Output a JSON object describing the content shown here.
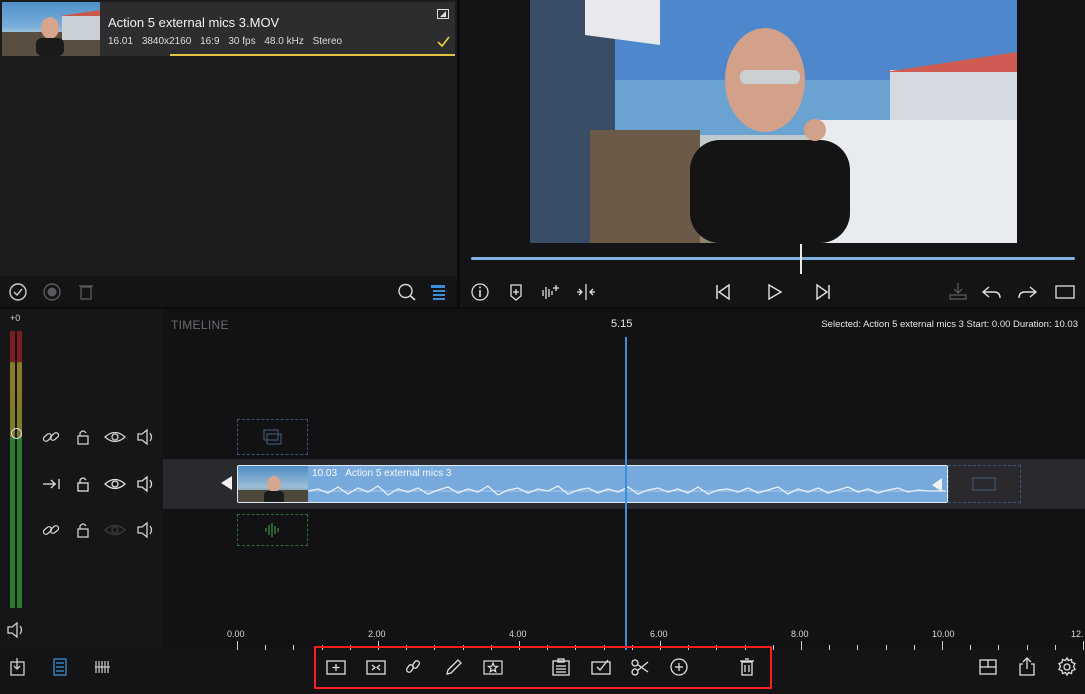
{
  "library": {
    "clip": {
      "name": "Action 5 external mics 3.MOV",
      "duration": "16.01",
      "resolution": "3840x2160",
      "aspect": "16:9",
      "fps": "30 fps",
      "sample_rate": "48.0 kHz",
      "channels": "Stereo",
      "progress": 0.63
    }
  },
  "timeline": {
    "label": "TIMELINE",
    "playhead_time": "5.15",
    "selection_info": "Selected: Action 5 external mics 3 Start: 0.00 Duration: 10.03",
    "clip": {
      "duration": "10.03",
      "name": "Action 5 external mics 3"
    },
    "ruler": [
      "0.00",
      "2.00",
      "4.00",
      "6.00",
      "8.00",
      "10.00",
      "12."
    ],
    "vu_label": "+0"
  },
  "colors": {
    "accent_blue": "#3a8fd6",
    "clip_blue": "#77a9dd",
    "highlight_red": "#ff1e1e",
    "progress_yellow": "#e4c441"
  },
  "icons": {
    "library_toolbar": [
      "check-circle-icon",
      "record-icon",
      "trash-icon",
      "search-icon",
      "layers-icon"
    ],
    "viewer_toolbar": [
      "info-icon",
      "marker-icon",
      "audio-waveform-add-icon",
      "split-icon",
      "skip-back-icon",
      "play-icon",
      "skip-forward-icon",
      "overwrite-icon",
      "undo-icon",
      "redo-icon",
      "fullscreen-icon"
    ],
    "track_header": [
      "link-icon",
      "lock-icon",
      "eye-icon",
      "speaker-icon"
    ],
    "bottom_left": [
      "import-icon",
      "list-view-icon",
      "waveform-view-icon"
    ],
    "bottom_center": [
      "add-title-icon",
      "add-transition-icon",
      "link-clip-icon",
      "pen-icon",
      "favorite-icon",
      "clipboard-icon",
      "check-box-icon",
      "scissors-icon",
      "add-circle-icon",
      "delete-icon"
    ],
    "bottom_right": [
      "layout-icon",
      "share-icon",
      "settings-icon"
    ]
  }
}
